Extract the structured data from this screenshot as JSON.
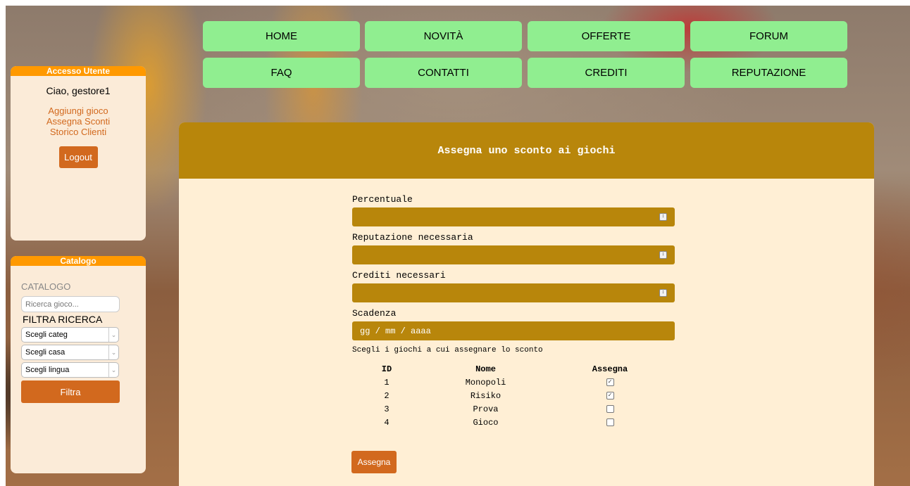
{
  "nav": {
    "row1": [
      "HOME",
      "NOVITÀ",
      "OFFERTE",
      "FORUM"
    ],
    "row2": [
      "FAQ",
      "CONTATTI",
      "CREDITI",
      "REPUTAZIONE"
    ]
  },
  "user_panel": {
    "header": "Accesso Utente",
    "greeting": "Ciao, gestore1",
    "links": [
      "Aggiungi gioco",
      "Assegna Sconti",
      "Storico Clienti"
    ],
    "logout_label": "Logout"
  },
  "catalog_panel": {
    "header": "Catalogo",
    "title": "CATALOGO",
    "search_placeholder": "Ricerca gioco...",
    "filter_title": "FILTRA RICERCA",
    "category_select": "Scegli categ",
    "house_select": "Scegli casa",
    "language_select": "Scegli lingua",
    "filter_button": "Filtra"
  },
  "main": {
    "title": "Assegna uno sconto ai giochi",
    "fields": {
      "percentage_label": "Percentuale",
      "reputation_label": "Reputazione necessaria",
      "credits_label": "Crediti necessari",
      "deadline_label": "Scadenza",
      "deadline_placeholder": "gg / mm / aaaa"
    },
    "games_note": "Scegli i giochi a cui assegnare lo sconto",
    "table": {
      "headers": [
        "ID",
        "Nome",
        "Assegna"
      ],
      "rows": [
        {
          "id": "1",
          "name": "Monopoli",
          "checked": true
        },
        {
          "id": "2",
          "name": "Risiko",
          "checked": true
        },
        {
          "id": "3",
          "name": "Prova",
          "checked": false
        },
        {
          "id": "4",
          "name": "Gioco",
          "checked": false
        }
      ]
    },
    "submit_label": "Assegna"
  },
  "icons": {
    "spin": "spin-arrows-icon",
    "checked": "☑",
    "unchecked": "☐",
    "dropdown": "chevron-down-icon"
  },
  "colors": {
    "nav": "#90ee90",
    "panel_header": "#ff9900",
    "accent": "#d2691e",
    "gold": "#b8860b",
    "panel_bg": "#fbebd8",
    "main_bg": "#ffefd5"
  }
}
